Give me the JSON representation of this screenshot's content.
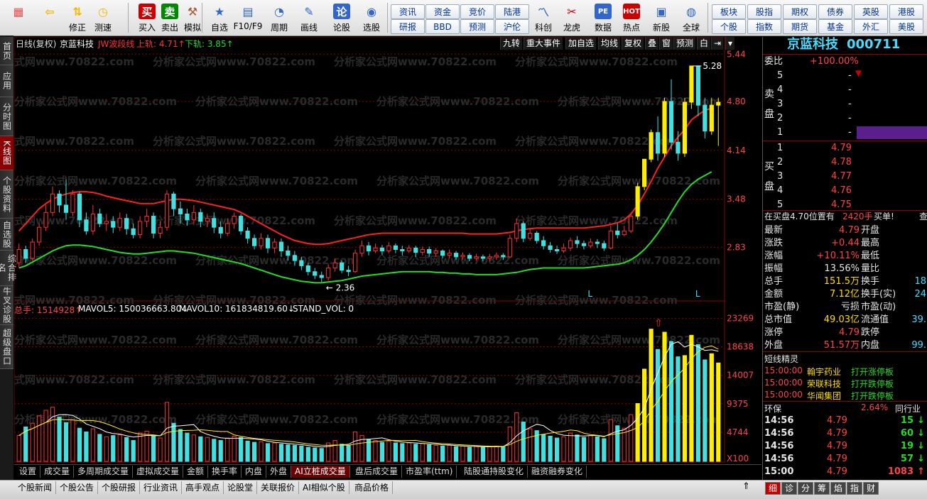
{
  "toolbar": {
    "buttons": [
      {
        "label": "",
        "icon": "windows-icon"
      },
      {
        "label": "",
        "icon": "back-arrow-icon"
      },
      {
        "label": "修正",
        "icon": "up-down-icon"
      },
      {
        "label": "测速",
        "icon": "clock-icon"
      },
      {
        "label": "买入",
        "icon": "buy-icon",
        "glyph": "买"
      },
      {
        "label": "卖出",
        "icon": "sell-icon",
        "glyph": "卖"
      },
      {
        "label": "模拟",
        "icon": "hammer-icon"
      },
      {
        "label": "自选",
        "icon": "star-icon"
      },
      {
        "label": "F10/F9",
        "icon": "f10-icon"
      },
      {
        "label": "周期",
        "icon": "cycle-icon"
      },
      {
        "label": "画线",
        "icon": "pencil-icon"
      },
      {
        "label": "论股",
        "icon": "discuss-icon",
        "glyph": "论"
      },
      {
        "label": "选股",
        "icon": "select-stock-icon"
      },
      {
        "label": "科创",
        "icon": "tech-icon"
      },
      {
        "label": "龙虎",
        "icon": "dragon-tiger-icon"
      },
      {
        "label": "数据",
        "icon": "data-icon",
        "glyph": "PE"
      },
      {
        "label": "热点",
        "icon": "hot-icon",
        "glyph": "HOT"
      },
      {
        "label": "新股",
        "icon": "ipo-icon"
      },
      {
        "label": "全球",
        "icon": "globe-icon"
      }
    ],
    "small": {
      "row1": [
        "资讯",
        "资金",
        "竞价",
        "陆港"
      ],
      "row2": [
        "研报",
        "BBD",
        "预测",
        "沪伦"
      ],
      "right_row1": [
        "板块",
        "股指",
        "期权",
        "债券",
        "英股",
        "港股"
      ],
      "right_row2": [
        "个股",
        "指数",
        "期货",
        "基金",
        "外汇",
        "美股"
      ]
    }
  },
  "left_tabs": [
    "首页",
    "应用",
    "分时图",
    "K线图",
    "个股资料",
    "自选股",
    "综合排名",
    "牛叉诊股",
    "超级盘口"
  ],
  "chart": {
    "header_left": "日线(复权)",
    "stock_name": "京蓝科技",
    "indicator_name": "JW波段线",
    "upper_label": "上轨: 4.71↑",
    "lower_label": "下轨: 3.85↑",
    "top_buttons": [
      "九转",
      "重大事件",
      "加自选",
      "均线",
      "复权",
      "叠",
      "窗",
      "预测",
      "白"
    ],
    "price_axis": [
      "5.44",
      "4.80",
      "4.14",
      "3.48",
      "2.83"
    ],
    "high_marker": "5.28",
    "low_marker": "2.36",
    "watermark": "分析家公式网www.70822.com",
    "markers": [
      "L",
      "L"
    ],
    "volume_header": {
      "total": "总手: 1514928↑",
      "mavol5": "MAVOL5: 150036663.80↓",
      "mavol10": "MAVOL10: 161834819.60↓",
      "stand": "STAND_VOL: 0"
    },
    "volume_axis": [
      "23269",
      "18638",
      "14007",
      "9375",
      "4744",
      "X100"
    ]
  },
  "chart_data": {
    "type": "candlestick",
    "price_range": [
      2.2,
      5.5
    ],
    "volume_range": [
      0,
      24000
    ],
    "candles": [
      [
        2.62,
        2.8,
        2.55,
        2.88
      ],
      [
        2.8,
        2.68,
        2.62,
        2.85
      ],
      [
        2.68,
        2.9,
        2.65,
        2.95
      ],
      [
        2.9,
        3.1,
        2.85,
        3.15
      ],
      [
        3.1,
        3.3,
        3.05,
        3.4
      ],
      [
        3.3,
        3.55,
        3.25,
        3.65
      ],
      [
        3.55,
        3.4,
        3.3,
        3.6
      ],
      [
        3.4,
        3.3,
        3.2,
        3.75
      ],
      [
        3.3,
        3.55,
        3.25,
        3.6
      ],
      [
        3.55,
        3.2,
        3.1,
        3.58
      ],
      [
        3.2,
        3.05,
        3.0,
        3.3
      ],
      [
        3.05,
        3.28,
        3.0,
        3.4
      ],
      [
        3.28,
        3.15,
        3.1,
        3.35
      ],
      [
        3.15,
        3.18,
        3.05,
        3.28
      ],
      [
        3.18,
        3.1,
        3.02,
        3.25
      ],
      [
        3.1,
        3.22,
        3.05,
        3.3
      ],
      [
        3.22,
        3.08,
        3.0,
        3.28
      ],
      [
        3.08,
        3.0,
        2.95,
        3.15
      ],
      [
        3.0,
        3.18,
        2.95,
        3.25
      ],
      [
        3.18,
        3.25,
        3.1,
        3.35
      ],
      [
        3.25,
        3.02,
        2.95,
        3.3
      ],
      [
        3.02,
        3.1,
        2.95,
        3.18
      ],
      [
        3.1,
        3.55,
        3.05,
        3.6
      ],
      [
        3.55,
        3.35,
        3.25,
        3.58
      ],
      [
        3.35,
        3.28,
        3.15,
        3.45
      ],
      [
        3.28,
        3.2,
        3.12,
        3.35
      ],
      [
        3.2,
        3.3,
        3.15,
        3.4
      ],
      [
        3.3,
        3.18,
        3.1,
        3.35
      ],
      [
        3.18,
        3.22,
        3.1,
        3.28
      ],
      [
        3.22,
        3.1,
        3.02,
        3.3
      ],
      [
        3.1,
        3.02,
        2.95,
        3.18
      ],
      [
        3.02,
        3.15,
        2.98,
        3.22
      ],
      [
        3.15,
        3.25,
        3.08,
        3.3
      ],
      [
        3.25,
        3.05,
        3.0,
        3.28
      ],
      [
        3.05,
        2.95,
        2.88,
        3.1
      ],
      [
        2.95,
        2.85,
        2.8,
        3.0
      ],
      [
        2.85,
        2.95,
        2.8,
        3.02
      ],
      [
        2.95,
        2.82,
        2.75,
        3.0
      ],
      [
        2.82,
        2.9,
        2.75,
        2.95
      ],
      [
        2.9,
        2.78,
        2.7,
        2.95
      ],
      [
        2.78,
        2.72,
        2.65,
        2.85
      ],
      [
        2.72,
        2.65,
        2.58,
        2.78
      ],
      [
        2.65,
        2.58,
        2.52,
        2.7
      ],
      [
        2.58,
        2.5,
        2.45,
        2.62
      ],
      [
        2.5,
        2.45,
        2.4,
        2.55
      ],
      [
        2.45,
        2.42,
        2.36,
        2.5
      ],
      [
        2.42,
        2.55,
        2.38,
        2.6
      ],
      [
        2.55,
        2.62,
        2.5,
        2.68
      ],
      [
        2.62,
        2.52,
        2.48,
        2.65
      ],
      [
        2.52,
        2.5,
        2.44,
        2.58
      ],
      [
        2.5,
        2.75,
        2.48,
        2.8
      ],
      [
        2.75,
        2.85,
        2.7,
        2.92
      ],
      [
        2.85,
        2.78,
        2.72,
        2.9
      ],
      [
        2.78,
        2.82,
        2.75,
        2.88
      ],
      [
        2.82,
        2.78,
        2.72,
        2.86
      ],
      [
        2.78,
        2.85,
        2.75,
        2.9
      ],
      [
        2.85,
        2.8,
        2.75,
        2.88
      ],
      [
        2.8,
        2.78,
        2.72,
        2.85
      ],
      [
        2.78,
        2.82,
        2.75,
        2.86
      ],
      [
        2.82,
        2.76,
        2.7,
        2.85
      ],
      [
        2.76,
        2.8,
        2.72,
        2.84
      ],
      [
        2.8,
        2.75,
        2.7,
        2.84
      ],
      [
        2.75,
        2.78,
        2.7,
        2.82
      ],
      [
        2.78,
        2.72,
        2.68,
        2.8
      ],
      [
        2.72,
        2.75,
        2.68,
        2.8
      ],
      [
        2.75,
        2.7,
        2.66,
        2.78
      ],
      [
        2.7,
        2.72,
        2.66,
        2.76
      ],
      [
        2.72,
        2.68,
        2.64,
        2.75
      ],
      [
        2.68,
        2.7,
        2.65,
        2.74
      ],
      [
        2.7,
        2.68,
        2.64,
        2.73
      ],
      [
        2.68,
        2.7,
        2.64,
        2.74
      ],
      [
        2.7,
        2.72,
        2.66,
        2.76
      ],
      [
        2.72,
        2.7,
        2.66,
        2.75
      ],
      [
        2.7,
        2.95,
        2.68,
        3.0
      ],
      [
        2.95,
        3.15,
        2.9,
        3.22
      ],
      [
        3.15,
        2.95,
        2.9,
        3.18
      ],
      [
        2.95,
        3.02,
        2.92,
        3.08
      ],
      [
        3.02,
        2.92,
        2.88,
        3.05
      ],
      [
        2.92,
        2.85,
        2.8,
        2.98
      ],
      [
        2.85,
        2.8,
        2.76,
        2.9
      ],
      [
        2.8,
        2.78,
        2.74,
        2.85
      ],
      [
        2.78,
        2.82,
        2.75,
        2.88
      ],
      [
        2.82,
        2.92,
        2.78,
        2.96
      ],
      [
        2.92,
        2.88,
        2.82,
        2.98
      ],
      [
        2.88,
        2.85,
        2.8,
        2.92
      ],
      [
        2.85,
        2.9,
        2.82,
        2.95
      ],
      [
        2.9,
        2.88,
        2.82,
        2.94
      ],
      [
        2.88,
        2.82,
        2.78,
        2.92
      ],
      [
        2.82,
        3.05,
        2.8,
        3.12
      ],
      [
        3.05,
        3.0,
        2.95,
        3.15
      ],
      [
        3.0,
        3.05,
        2.98,
        3.12
      ],
      [
        3.05,
        3.25,
        3.02,
        3.3
      ],
      [
        3.25,
        3.65,
        3.2,
        3.7
      ],
      [
        3.65,
        4.02,
        3.6,
        4.02
      ],
      [
        4.02,
        4.38,
        3.98,
        4.42
      ],
      [
        4.38,
        4.1,
        4.0,
        4.6
      ],
      [
        4.1,
        4.8,
        4.05,
        4.85
      ],
      [
        4.8,
        4.25,
        4.15,
        5.1
      ],
      [
        4.25,
        4.1,
        4.0,
        4.4
      ],
      [
        4.1,
        4.79,
        4.05,
        4.85
      ],
      [
        4.79,
        5.28,
        4.7,
        5.28
      ],
      [
        5.28,
        4.75,
        4.6,
        5.2
      ],
      [
        4.75,
        4.4,
        4.3,
        4.85
      ],
      [
        4.4,
        4.75,
        4.35,
        4.85
      ],
      [
        4.75,
        4.79,
        4.2,
        4.85
      ]
    ],
    "volumes": [
      4200,
      5600,
      6200,
      7400,
      8300,
      8800,
      7200,
      6300,
      6700,
      5400,
      4800,
      5300,
      4400,
      4000,
      4200,
      4300,
      3900,
      3400,
      4600,
      4900,
      4100,
      3800,
      9600,
      6200,
      5200,
      4600,
      4300,
      4000,
      3900,
      3600,
      3400,
      3800,
      4100,
      3900,
      3300,
      3100,
      3200,
      2900,
      3000,
      2800,
      2700,
      2600,
      2500,
      2300,
      2200,
      2100,
      3000,
      3400,
      2800,
      2600,
      4800,
      4200,
      3600,
      3400,
      3100,
      3300,
      3000,
      2900,
      3000,
      2800,
      2900,
      2700,
      2600,
      2500,
      2600,
      2400,
      2500,
      2300,
      2400,
      2300,
      2400,
      2500,
      2400,
      5600,
      7900,
      6400,
      5300,
      5000,
      4400,
      4100,
      3800,
      4000,
      4600,
      4300,
      3900,
      4200,
      4000,
      3700,
      6800,
      5800,
      5400,
      7600,
      9400,
      15000,
      21500,
      18200,
      21000,
      19500,
      17000,
      17200,
      20500,
      19000,
      16500,
      17500,
      16000
    ],
    "upper_band": [
      3.05,
      3.15,
      3.25,
      3.35,
      3.42,
      3.48,
      3.52,
      3.55,
      3.57,
      3.58,
      3.58,
      3.57,
      3.55,
      3.52,
      3.5,
      3.48,
      3.46,
      3.44,
      3.42,
      3.42,
      3.42,
      3.44,
      3.46,
      3.48,
      3.48,
      3.47,
      3.46,
      3.44,
      3.42,
      3.4,
      3.38,
      3.36,
      3.34,
      3.3,
      3.25,
      3.2,
      3.15,
      3.1,
      3.05,
      3.0,
      2.96,
      2.92,
      2.9,
      2.88,
      2.87,
      2.87,
      2.88,
      2.9,
      2.92,
      2.94,
      2.96,
      2.98,
      3.0,
      3.01,
      3.02,
      3.02,
      3.02,
      3.02,
      3.02,
      3.02,
      3.02,
      3.02,
      3.02,
      3.02,
      3.02,
      3.02,
      3.02,
      3.01,
      3.01,
      3.01,
      3.01,
      3.01,
      3.02,
      3.03,
      3.05,
      3.07,
      3.08,
      3.09,
      3.09,
      3.09,
      3.09,
      3.09,
      3.09,
      3.09,
      3.09,
      3.1,
      3.11,
      3.12,
      3.14,
      3.16,
      3.2,
      3.28,
      3.4,
      3.55,
      3.72,
      3.9,
      4.05,
      4.2,
      4.32,
      4.42,
      4.55,
      4.62,
      4.68,
      4.71
    ],
    "lower_band": [
      2.55,
      2.58,
      2.63,
      2.68,
      2.73,
      2.78,
      2.82,
      2.85,
      2.86,
      2.86,
      2.85,
      2.84,
      2.82,
      2.8,
      2.78,
      2.76,
      2.75,
      2.74,
      2.74,
      2.75,
      2.76,
      2.77,
      2.78,
      2.78,
      2.77,
      2.76,
      2.75,
      2.73,
      2.71,
      2.69,
      2.67,
      2.65,
      2.63,
      2.61,
      2.58,
      2.55,
      2.52,
      2.49,
      2.46,
      2.43,
      2.41,
      2.39,
      2.37,
      2.36,
      2.35,
      2.35,
      2.36,
      2.37,
      2.38,
      2.4,
      2.42,
      2.44,
      2.45,
      2.46,
      2.47,
      2.48,
      2.49,
      2.5,
      2.5,
      2.5,
      2.5,
      2.5,
      2.49,
      2.49,
      2.48,
      2.48,
      2.47,
      2.47,
      2.46,
      2.46,
      2.46,
      2.46,
      2.47,
      2.48,
      2.49,
      2.51,
      2.53,
      2.54,
      2.55,
      2.55,
      2.55,
      2.55,
      2.55,
      2.55,
      2.55,
      2.56,
      2.57,
      2.58,
      2.59,
      2.6,
      2.62,
      2.66,
      2.72,
      2.8,
      2.9,
      3.02,
      3.15,
      3.3,
      3.45,
      3.58,
      3.68,
      3.75,
      3.8,
      3.85
    ]
  },
  "quote": {
    "name": "京蓝科技",
    "code": "000711",
    "wei_bi_label": "委比",
    "wei_bi_value": "+100.00%",
    "sell_label": [
      "卖",
      "盘"
    ],
    "buy_label": [
      "买",
      "盘"
    ],
    "sell_levels": [
      "5",
      "4",
      "3",
      "2",
      "1"
    ],
    "buy_rows": [
      {
        "lvl": "1",
        "price": "4.79"
      },
      {
        "lvl": "2",
        "price": "4.78"
      },
      {
        "lvl": "3",
        "price": "4.77"
      },
      {
        "lvl": "4",
        "price": "4.76"
      },
      {
        "lvl": "5",
        "price": "4.75"
      }
    ],
    "bid_info": "在买盘4.70位置有",
    "bid_qty": "2420手",
    "bid_action": "买单!",
    "bid_more": "查",
    "stats": [
      {
        "l": "最新",
        "v": "4.79",
        "vc": "red",
        "l2": "开盘"
      },
      {
        "l": "涨跌",
        "v": "+0.44",
        "vc": "red",
        "l2": "最高"
      },
      {
        "l": "涨幅",
        "v": "+10.11%",
        "vc": "red",
        "l2": "最低"
      },
      {
        "l": "振幅",
        "v": "13.56%",
        "vc": "white",
        "l2": "量比"
      },
      {
        "l": "总手",
        "v": "151.5万",
        "vc": "yellow",
        "l2": "换手",
        "v2": "18"
      },
      {
        "l": "金额",
        "v": "7.12亿",
        "vc": "yellow",
        "l2": "换手(实)",
        "v2": "24"
      },
      {
        "l": "市盈(静)",
        "v": "亏损",
        "vc": "white",
        "l2": "市盈(动)"
      },
      {
        "l": "总市值",
        "v": "49.03亿",
        "vc": "yellow",
        "l2": "流通值",
        "v2": "39."
      },
      {
        "l": "涨停",
        "v": "4.79",
        "vc": "red",
        "l2": "跌停"
      },
      {
        "l": "外盘",
        "v": "51.57万",
        "vc": "red",
        "l2": "内盘",
        "v2": "99."
      }
    ],
    "wizard_title": "短线精灵",
    "wizard": [
      {
        "t": "15:00:00",
        "n": "翰宇药业",
        "e": "打开涨停板"
      },
      {
        "t": "15:00:00",
        "n": "荣联科技",
        "e": "打开跌停板"
      },
      {
        "t": "15:00:00",
        "n": "华闻集团",
        "e": "打开跌停板"
      }
    ],
    "sector_name": "环保",
    "sector_pct": "2.64%",
    "sector_peer": "同行业",
    "ticks": [
      {
        "t": "14:56",
        "p": "4.79",
        "v": "15",
        "d": "down"
      },
      {
        "t": "14:56",
        "p": "4.79",
        "v": "60",
        "d": "down"
      },
      {
        "t": "14:56",
        "p": "4.79",
        "v": "19",
        "d": "down"
      },
      {
        "t": "14:56",
        "p": "4.79",
        "v": "57",
        "d": "down"
      },
      {
        "t": "15:00",
        "p": "4.79",
        "v": "1083",
        "d": "up"
      }
    ]
  },
  "bottom_tabs": [
    "设置",
    "成交量",
    "多周期成交量",
    "虚拟成交量",
    "金额",
    "换手率",
    "内盘",
    "外盘",
    "AI立桩成交量",
    "盘后成交量",
    "市盈率(ttm)",
    "陆股通持股变化",
    "融资融券变化"
  ],
  "status_tabs": [
    "个股新闻",
    "个股公告",
    "个股研报",
    "行业资讯",
    "高手观点",
    "论股堂",
    "关联报价",
    "AI相似个股",
    "商品价格"
  ],
  "right_tabs": [
    "细",
    "诊",
    "分",
    "筹",
    "焰",
    "指",
    "财"
  ]
}
